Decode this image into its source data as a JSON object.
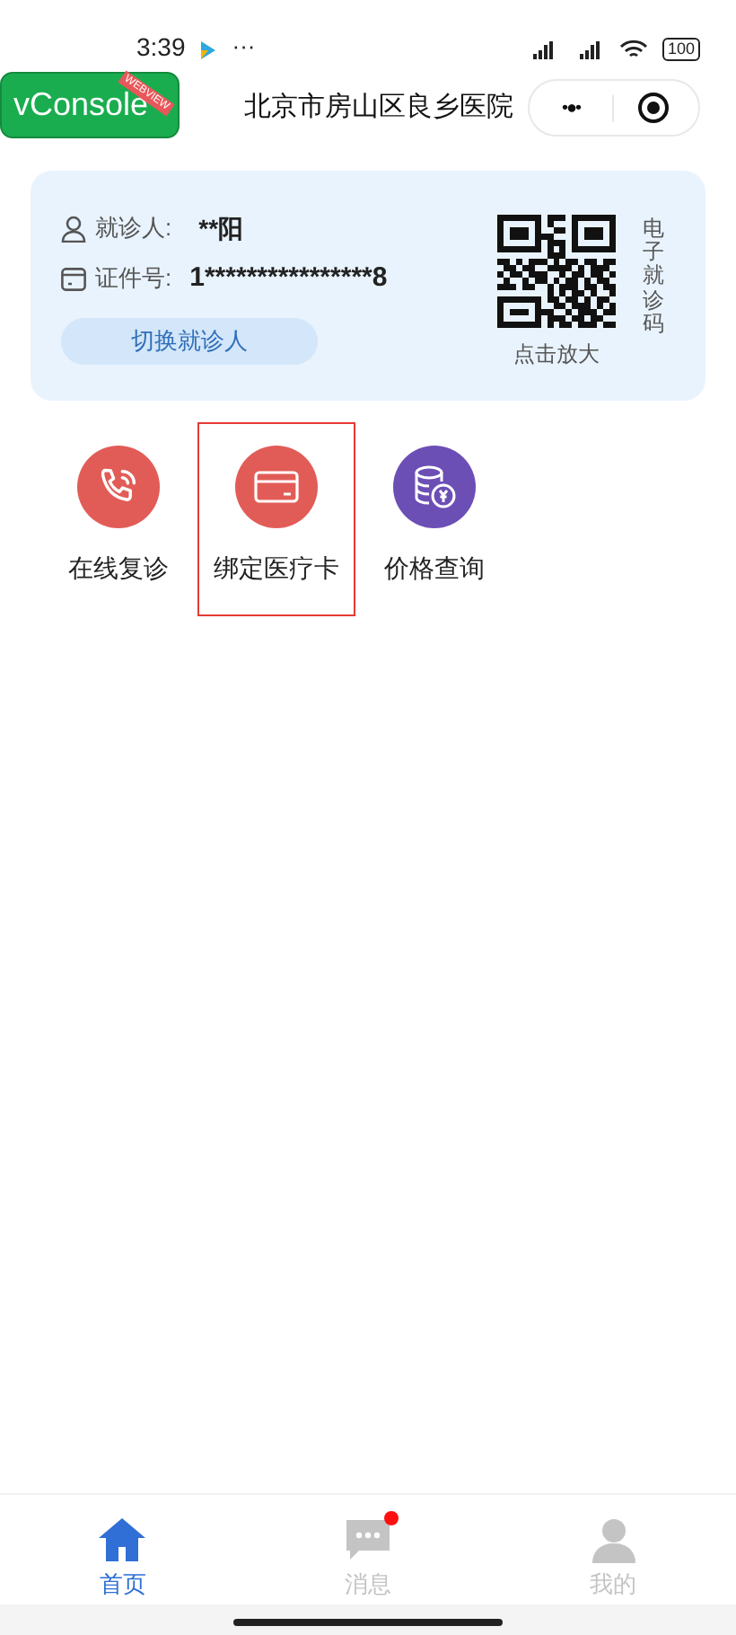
{
  "status_bar": {
    "time": "3:39",
    "notification_dots": "···",
    "battery": "100"
  },
  "nav_bar": {
    "vconsole": "vConsole",
    "vconsole_ribbon": "WEBVIEW",
    "title": "北京市房山区良乡医院",
    "more": "•●•"
  },
  "patient_card": {
    "patient_label": "就诊人:",
    "patient_name": "**阳",
    "id_label": "证件号:",
    "id_number": "1****************8",
    "switch_button": "切换就诊人",
    "qr_caption": "点击放大",
    "qr_side_label": "电子就诊码"
  },
  "services": [
    {
      "kind": "phone",
      "label": "在线复诊",
      "color": "#e25c57",
      "highlighted": false
    },
    {
      "kind": "card",
      "label": "绑定医疗卡",
      "color": "#e25c57",
      "highlighted": true
    },
    {
      "kind": "coins",
      "label": "价格查询",
      "color": "#6c4fb5",
      "highlighted": false
    }
  ],
  "tab_bar": [
    {
      "kind": "home",
      "label": "首页",
      "selected": true,
      "badge": false
    },
    {
      "kind": "message",
      "label": "消息",
      "selected": false,
      "badge": true
    },
    {
      "kind": "profile",
      "label": "我的",
      "selected": false,
      "badge": false
    }
  ]
}
